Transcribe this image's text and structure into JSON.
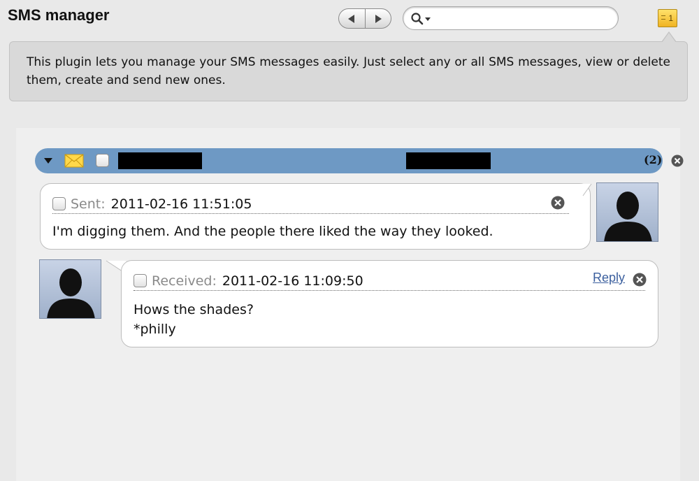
{
  "header": {
    "title": "SMS manager",
    "search": {
      "value": "",
      "placeholder": ""
    },
    "notes_badge": "1"
  },
  "info": {
    "text": "This plugin lets you manage your SMS messages easily. Just select any or all SMS messages, view or delete them, create and send new ones."
  },
  "conversation": {
    "count_label": "(2)",
    "bar_color": "#6e99c4"
  },
  "messages": [
    {
      "direction": "sent",
      "label": "Sent:",
      "timestamp": "2011-02-16 11:51:05",
      "body_lines": [
        "I'm digging them. And the people there liked the way they looked."
      ]
    },
    {
      "direction": "received",
      "label": "Received:",
      "timestamp": "2011-02-16 11:09:50",
      "reply_label": "Reply",
      "body_lines": [
        "Hows the shades?",
        "*philly"
      ]
    }
  ]
}
